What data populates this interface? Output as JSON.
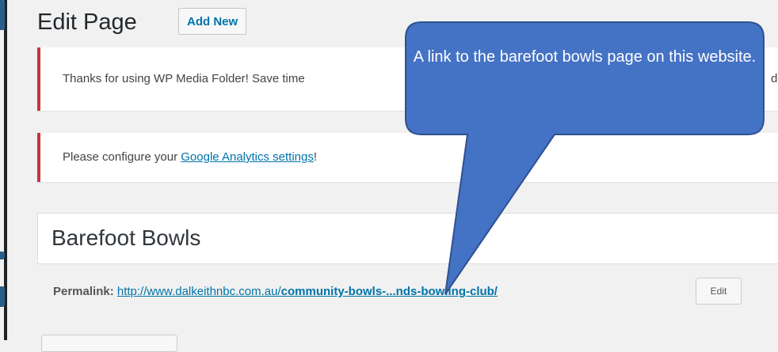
{
  "header": {
    "title": "Edit Page",
    "add_new_label": "Add New"
  },
  "notices": {
    "media_folder_text": "Thanks for using WP Media Folder! Save time",
    "media_folder_trailing": "de",
    "analytics_prefix": "Please configure your ",
    "analytics_link": "Google Analytics settings",
    "analytics_suffix": "!"
  },
  "editor": {
    "page_title_value": "Barefoot Bowls"
  },
  "permalink": {
    "label": "Permalink:",
    "url_prefix": "http://www.dalkeithnbc.com.au/",
    "url_slug": "community-bowls-...nds-bowling-club/",
    "edit_label": "Edit"
  },
  "callout": {
    "text": "A link to the barefoot bowls page on this website."
  },
  "colors": {
    "callout_fill": "#4472c4",
    "callout_stroke": "#2f528f",
    "notice_border": "#c9333f",
    "link": "#0073aa"
  }
}
